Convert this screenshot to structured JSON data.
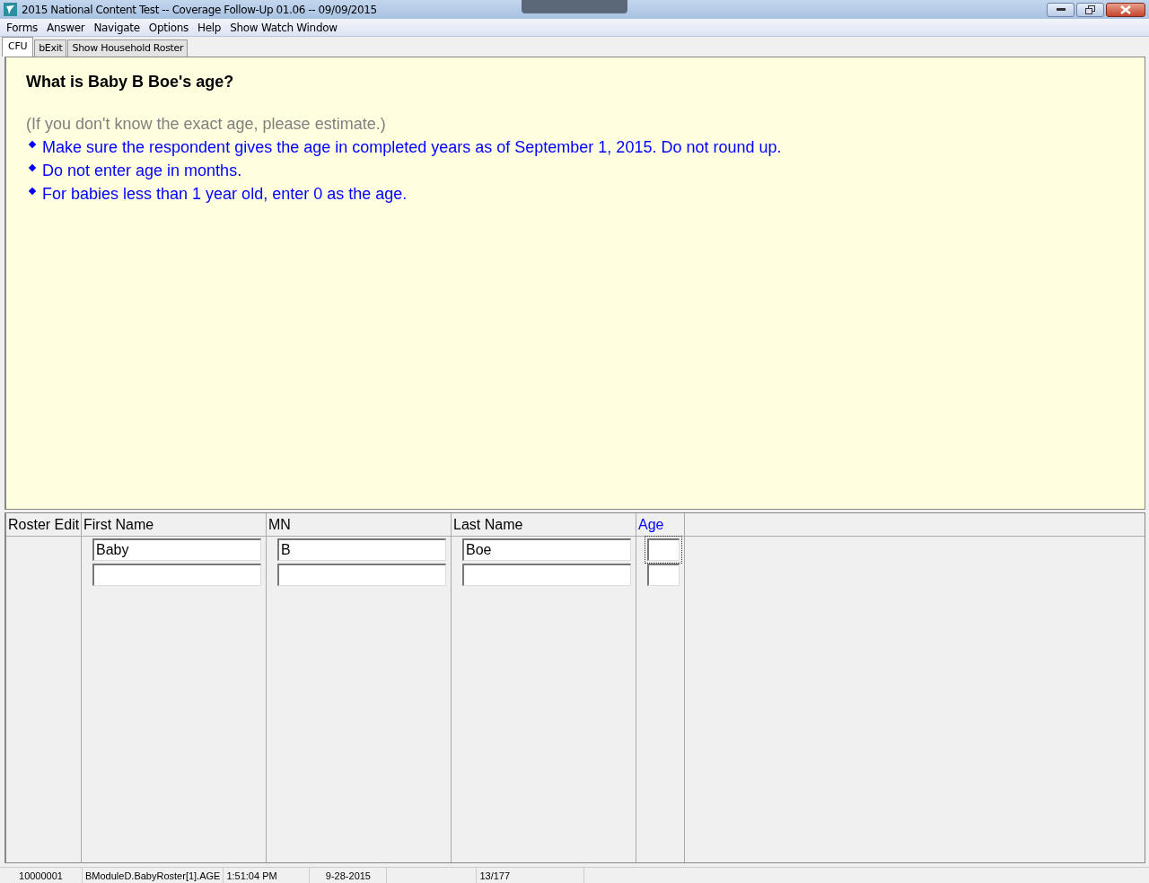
{
  "window": {
    "title": "2015 National Content Test -- Coverage Follow-Up 01.06 -- 09/09/2015"
  },
  "menu": [
    "Forms",
    "Answer",
    "Navigate",
    "Options",
    "Help",
    "Show Watch Window"
  ],
  "tabs": [
    {
      "label": "CFU",
      "selected": true
    },
    {
      "label": "bExit",
      "selected": false
    },
    {
      "label": "Show Household Roster",
      "selected": false
    }
  ],
  "question": {
    "title": "What is Baby B Boe's age?",
    "hint": "(If you don't know the exact age, please estimate.)",
    "instructions": [
      "Make sure the respondent gives the age in completed years as of September 1, 2015. Do not round up.",
      "Do not enter age in months.",
      "For babies less than 1 year old, enter 0 as the age."
    ]
  },
  "roster": {
    "columns": [
      {
        "label": "Roster Edit",
        "current": false
      },
      {
        "label": "First Name",
        "current": false
      },
      {
        "label": "MN",
        "current": false
      },
      {
        "label": "Last Name",
        "current": false
      },
      {
        "label": "Age",
        "current": true
      }
    ],
    "rows": [
      {
        "cells": [
          {
            "kind": "blank"
          },
          {
            "kind": "input",
            "value": "Baby",
            "focused": false
          },
          {
            "kind": "input",
            "value": "B",
            "focused": false
          },
          {
            "kind": "input",
            "value": "Boe",
            "focused": false
          },
          {
            "kind": "input",
            "focused": true
          }
        ]
      },
      {
        "cells": [
          {
            "kind": "blank"
          },
          {
            "kind": "input",
            "focused": false
          },
          {
            "kind": "input",
            "focused": false
          },
          {
            "kind": "input",
            "focused": false
          },
          {
            "kind": "input",
            "focused": false
          }
        ]
      }
    ]
  },
  "status_bar": [
    "10000001",
    "BModuleD.BabyRoster[1].AGE",
    "1:51:04 PM",
    "9-28-2015",
    "13/177"
  ]
}
